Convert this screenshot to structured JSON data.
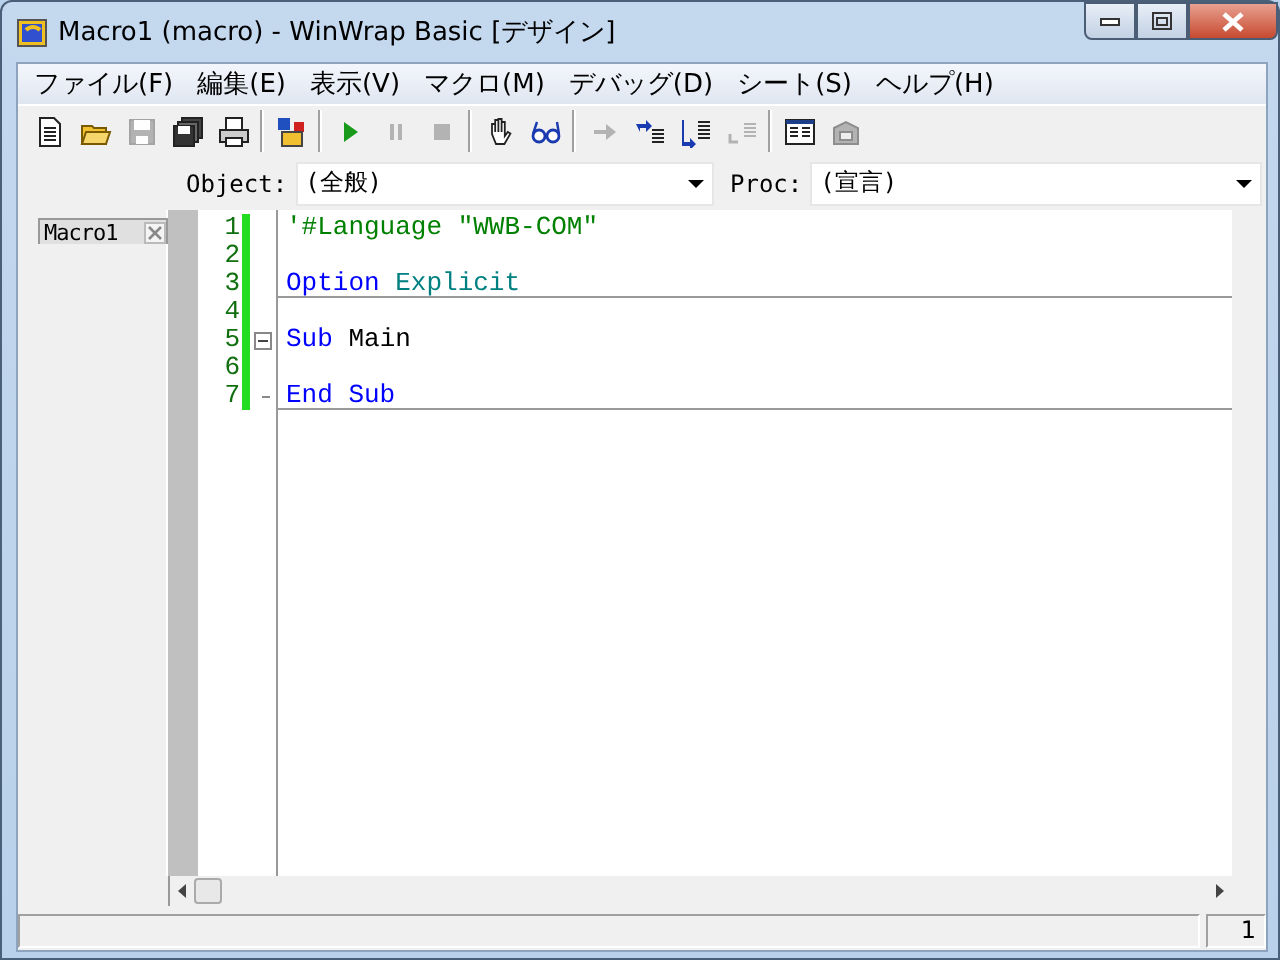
{
  "window": {
    "title": "Macro1 (macro) - WinWrap Basic [デザイン]"
  },
  "menu": [
    {
      "label": "ファイル(F)"
    },
    {
      "label": "編集(E)"
    },
    {
      "label": "表示(V)"
    },
    {
      "label": "マクロ(M)"
    },
    {
      "label": "デバッグ(D)"
    },
    {
      "label": "シート(S)"
    },
    {
      "label": "ヘルプ(H)"
    }
  ],
  "toolbar": [
    {
      "kind": "new",
      "disabled": false
    },
    {
      "kind": "open",
      "disabled": false
    },
    {
      "kind": "save",
      "disabled": true
    },
    {
      "kind": "save-all",
      "disabled": false
    },
    {
      "kind": "print",
      "disabled": false
    },
    {
      "kind": "separator"
    },
    {
      "kind": "dialog",
      "disabled": false
    },
    {
      "kind": "separator"
    },
    {
      "kind": "run",
      "disabled": false
    },
    {
      "kind": "pause",
      "disabled": true
    },
    {
      "kind": "stop",
      "disabled": true
    },
    {
      "kind": "separator"
    },
    {
      "kind": "hand",
      "disabled": false
    },
    {
      "kind": "watch",
      "disabled": false
    },
    {
      "kind": "separator"
    },
    {
      "kind": "arrow",
      "disabled": true
    },
    {
      "kind": "step-into",
      "disabled": false
    },
    {
      "kind": "step-over",
      "disabled": false
    },
    {
      "kind": "step-out",
      "disabled": true
    },
    {
      "kind": "separator"
    },
    {
      "kind": "browser",
      "disabled": false
    },
    {
      "kind": "references",
      "disabled": true
    }
  ],
  "object_selector": {
    "label": "Object:",
    "value": "(全般)"
  },
  "proc_selector": {
    "label": "Proc:",
    "value": "(宣言)"
  },
  "sheet_tabs": [
    {
      "label": "Macro1",
      "selected": true
    }
  ],
  "code_lines": [
    {
      "number": "1",
      "fold_start": false,
      "fold_end": false,
      "separator": false,
      "tokens": [
        {
          "kind": "comment",
          "text": "'#Language \"WWB-COM\""
        }
      ]
    },
    {
      "number": "2",
      "fold_start": false,
      "fold_end": false,
      "separator": false
    },
    {
      "number": "3",
      "fold_start": false,
      "fold_end": false,
      "separator": true,
      "tokens": [
        {
          "kind": "keyword",
          "text": "Option"
        },
        {
          "kind": "directive",
          "text": "Explicit"
        }
      ]
    },
    {
      "number": "4",
      "fold_start": false,
      "fold_end": false,
      "separator": false
    },
    {
      "number": "5",
      "fold_start": true,
      "fold_end": false,
      "separator": false,
      "tokens": [
        {
          "kind": "keyword",
          "text": "Sub"
        },
        {
          "kind": "plain",
          "text": "Main"
        }
      ]
    },
    {
      "number": "6",
      "fold_start": false,
      "fold_end": false,
      "separator": false
    },
    {
      "number": "7",
      "fold_start": false,
      "fold_end": true,
      "separator": true,
      "tokens": [
        {
          "kind": "keyword",
          "text": "End Sub"
        }
      ]
    }
  ],
  "status_bar": {
    "line": "1"
  }
}
